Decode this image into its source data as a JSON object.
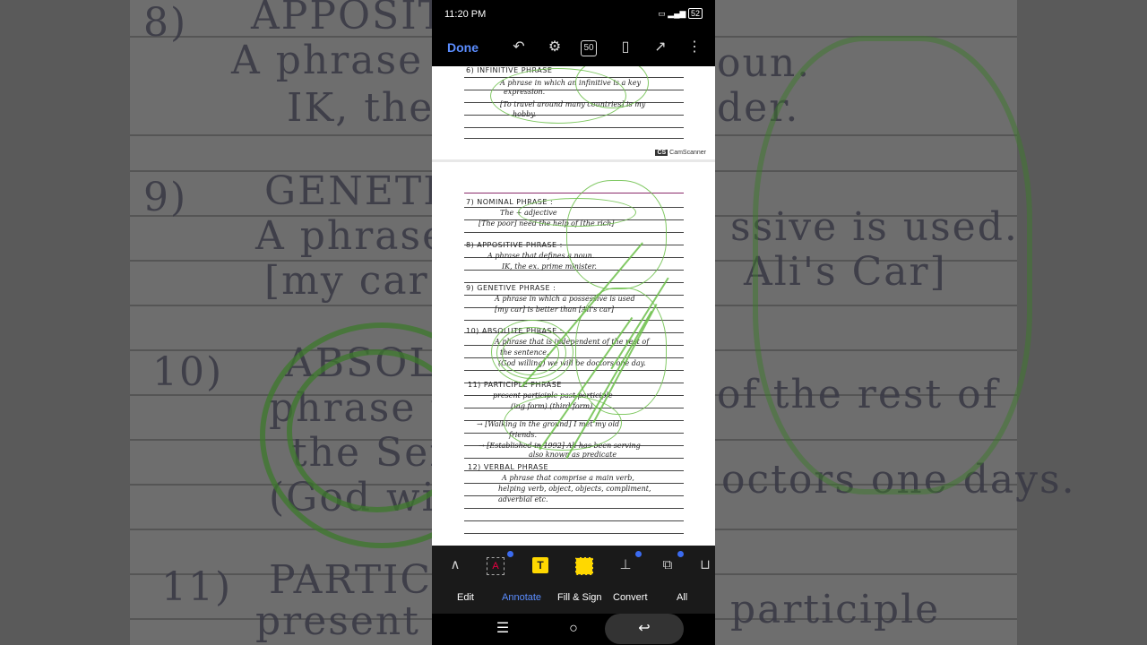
{
  "status_bar": {
    "time": "11:20 PM",
    "battery": "52"
  },
  "toolbar": {
    "done_label": "Done",
    "page_badge": "50"
  },
  "document": {
    "page_top": {
      "lines": [
        "6) INFINITIVE PHRASE",
        "A phrase in which an infinitive is a key",
        "expression.",
        "[To travel around many countries] is my",
        "hobby."
      ],
      "watermark": "CamScanner"
    },
    "page_main": {
      "lines": [
        "7) NOMINAL PHRASE :",
        "The + adjective",
        "[The poor] need the help of [the rich]",
        "8) APPOSITIVE PHRASE :",
        "A phrase that defines a noun.",
        "IK, the ex. prime minister.",
        "9) GENETIVE PHRASE :",
        "A phrase in which a possessive is used",
        "[my car] is better than [Ali's car]",
        "10) ABSOLUTE PHRASE :",
        "A phrase that is independent of the rest of",
        "the sentence.",
        "(God willing) we will be doctors one day.",
        "11) PARTICIPLE PHRASE",
        "present participle        past participle",
        "(ing form)                    (third form)",
        "→ [Walking in the ground] I met my old",
        "friends.",
        "→ [Established in 1992] Ali has been serving",
        "also known as predicate",
        "12) VERBAL PHRASE",
        "A phrase that comprise a main verb,",
        "helping verb, object, objects, compliment,",
        "adverbial etc."
      ]
    }
  },
  "annotate_bar": {
    "tools": [
      "pen-icon",
      "text-box-icon",
      "text-highlight-icon",
      "area-highlight-icon",
      "stamp-icon",
      "shapes-icon"
    ],
    "tabs": [
      "Edit",
      "Annotate",
      "Fill & Sign",
      "Convert",
      "All"
    ],
    "active_tab": "Annotate"
  },
  "background": {
    "lines": [
      "8)",
      "APPOSITIVE",
      "A phrase th",
      "IK, the",
      "9)",
      "GENETIVE",
      "A phrase i",
      "[my car",
      "10)",
      "ABSOLUTE",
      "phrase th",
      "the Sente",
      "(God wi",
      "11)",
      "PARTICIPLE",
      "present pa",
      "ssive is used.",
      "Ali's Car]",
      "of the rest of",
      "octors one days.",
      "participle",
      "oun.",
      "der."
    ]
  },
  "colors": {
    "accent": "#5b8dff",
    "ink_green": "#6cc04a",
    "highlight_yellow": "#ffd800"
  }
}
